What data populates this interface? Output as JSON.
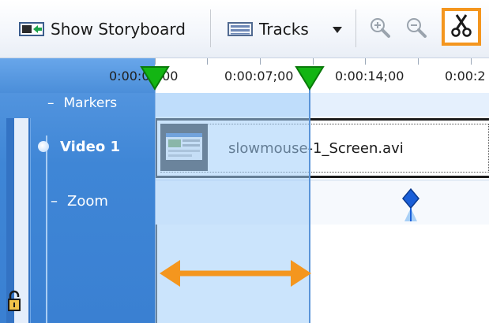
{
  "toolbar": {
    "show_storyboard_label": "Show Storyboard",
    "tracks_label": "Tracks",
    "icons": {
      "storyboard": "storyboard-icon",
      "tracks": "tracks-icon",
      "dropdown": "chevron-down-icon",
      "zoom_in": "zoom-in-icon",
      "zoom_out": "zoom-out-icon",
      "cut": "scissors-icon"
    },
    "highlight_color": "#f4961e"
  },
  "ruler": {
    "times": [
      "0:00:00;00",
      "0:00:07;00",
      "0:00:14;00",
      "0:00:2"
    ]
  },
  "tracks": {
    "markers_label": "Markers",
    "video_label": "Video 1",
    "zoom_label": "Zoom"
  },
  "clip": {
    "name": "slowmouse-1_Screen.avi"
  },
  "colors": {
    "panel_blue": "#3f86d6",
    "selection": "#a0cdfa",
    "marker_green": "#13b513",
    "arrow_orange": "#f4961e",
    "keyframe_blue": "#1a5fd8"
  }
}
